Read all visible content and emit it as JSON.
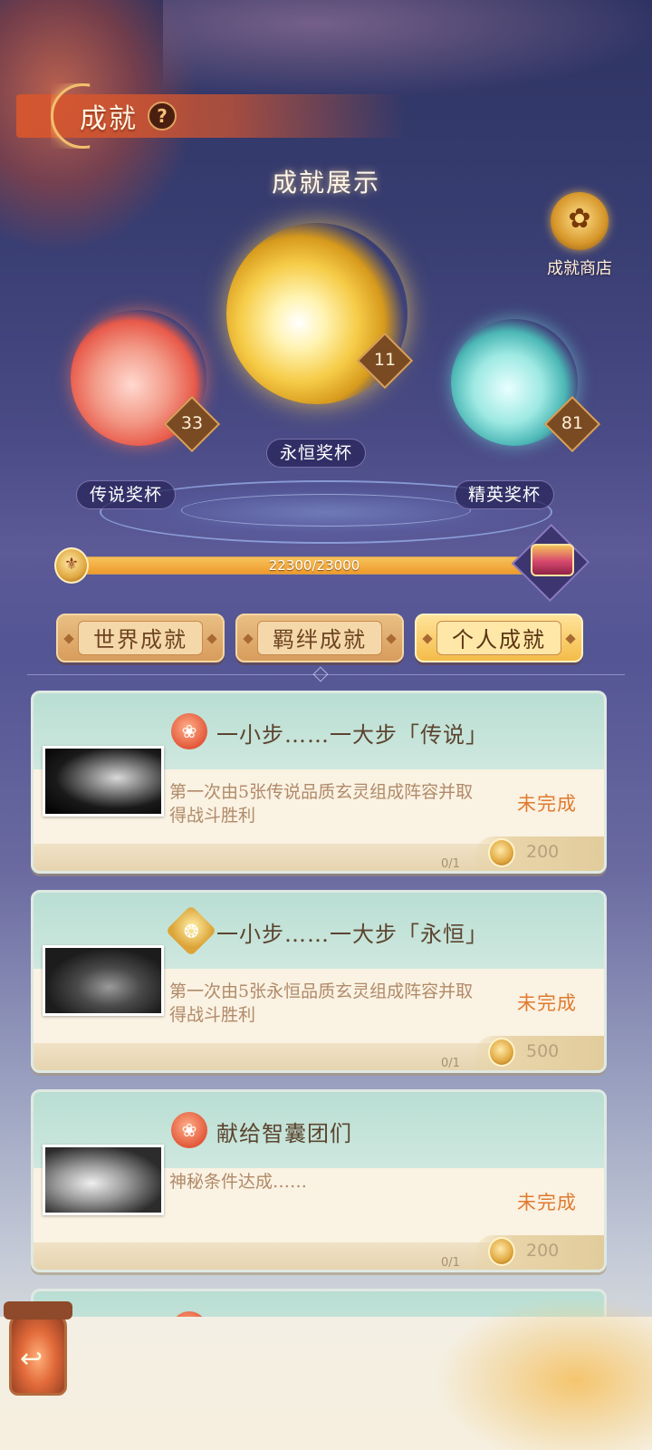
{
  "header": {
    "title": "成就",
    "help_icon": "question-icon"
  },
  "display": {
    "title": "成就展示"
  },
  "shop": {
    "label": "成就商店",
    "icon": "lotus-dragon-icon"
  },
  "trophies": [
    {
      "name": "传说奖杯",
      "count": "33",
      "color": "#f37a5a"
    },
    {
      "name": "永恒奖杯",
      "count": "11",
      "color": "#f4c84a"
    },
    {
      "name": "精英奖杯",
      "count": "81",
      "color": "#7cd9d2"
    }
  ],
  "progress": {
    "current": 22300,
    "max": 23000,
    "text": "22300/23000",
    "fraction": 0.9696
  },
  "tabs": [
    {
      "label": "世界成就",
      "active": false
    },
    {
      "label": "羁绊成就",
      "active": false
    },
    {
      "label": "个人成就",
      "active": true
    }
  ],
  "achievements": [
    {
      "title": "一小步……一大步「传说」",
      "icon": "legend-emblem-icon",
      "description": "第一次由5张传说品质玄灵组成阵容并取得战斗胜利",
      "status": "未完成",
      "progress": "0/1",
      "reward": "200"
    },
    {
      "title": "一小步……一大步「永恒」",
      "icon": "eternal-emblem-icon",
      "description": "第一次由5张永恒品质玄灵组成阵容并取得战斗胜利",
      "status": "未完成",
      "progress": "0/1",
      "reward": "500"
    },
    {
      "title": "献给智囊团们",
      "icon": "legend-emblem-icon",
      "description": "神秘条件达成……",
      "status": "未完成",
      "progress": "0/1",
      "reward": "200"
    }
  ],
  "back": {
    "icon": "back-arrow-icon"
  }
}
